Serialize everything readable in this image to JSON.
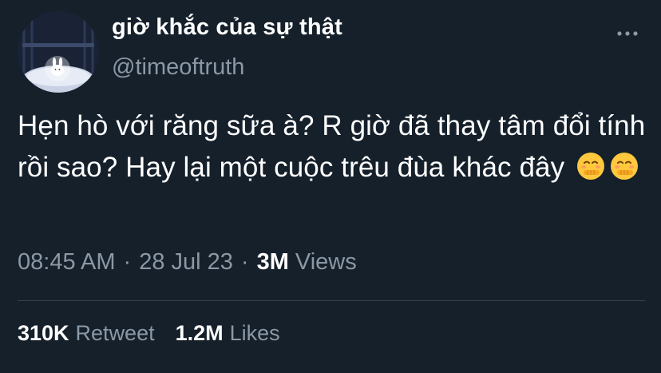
{
  "author": {
    "display_name": "giờ khắc của sự thật",
    "handle": "@timeoftruth"
  },
  "tweet": {
    "text": "Hẹn hò với răng sữa à? R giờ đã thay tâm đổi tính rồi sao? Hay lại một cuộc trêu đùa khác đây",
    "emoji": [
      "face-with-hand-over-mouth",
      "face-with-hand-over-mouth"
    ]
  },
  "meta": {
    "time": "08:45 AM",
    "date": "28 Jul 23",
    "separator": "·",
    "views_count": "3M",
    "views_label": "Views"
  },
  "stats": {
    "retweets_count": "310K",
    "retweets_label": "Retweet",
    "likes_count": "1.2M",
    "likes_label": "Likes"
  },
  "colors": {
    "background": "#15202b",
    "primary_text": "#ffffff",
    "secondary_text": "#8b98a5",
    "divider": "#38444d"
  }
}
